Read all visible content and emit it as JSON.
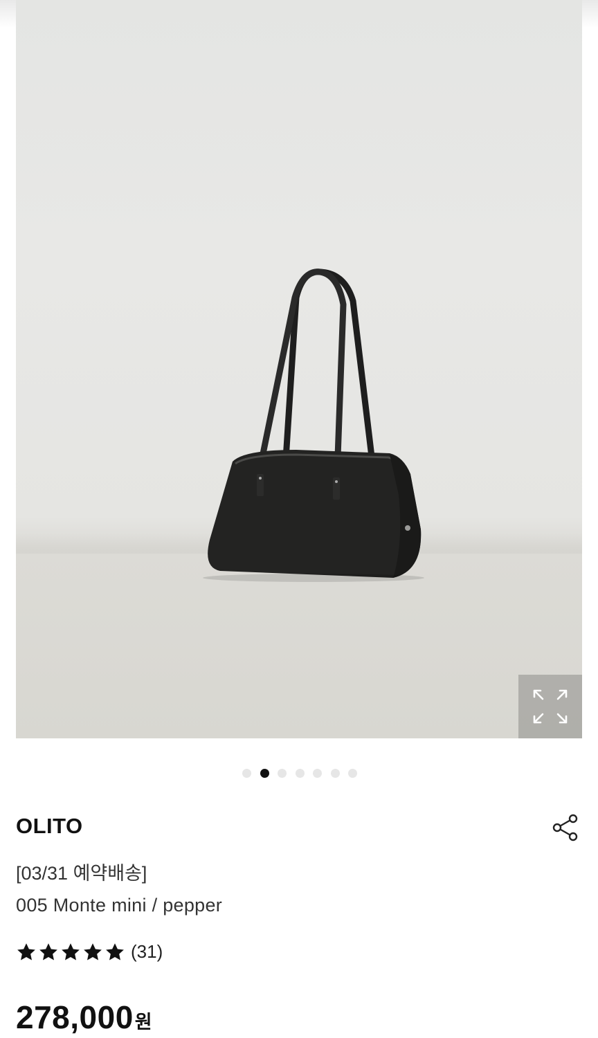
{
  "product": {
    "brand": "OLITO",
    "delivery_tag": "[03/31 예약배송]",
    "name": "005 Monte mini / pepper",
    "rating": 5,
    "review_count": "(31)",
    "price": "278,000",
    "price_unit": "원"
  },
  "gallery": {
    "total_images": 7,
    "active_index": 1,
    "image_subject": "black leather shoulder bag"
  },
  "icons": {
    "zoom": "expand-arrows-icon",
    "share": "share-icon",
    "star": "star-icon"
  },
  "colors": {
    "dot_active": "#111111",
    "dot_inactive": "#e6e6e6",
    "text": "#111111"
  }
}
